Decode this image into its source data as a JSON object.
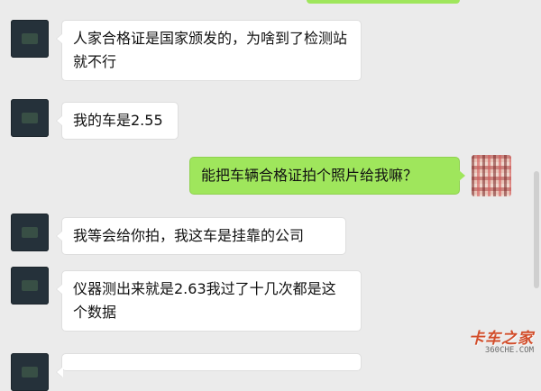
{
  "chat": {
    "messages": [
      {
        "sender": "contact",
        "text": "人家合格证是国家颁发的，为啥到了检测站就不行"
      },
      {
        "sender": "contact",
        "text": "我的车是2.55"
      },
      {
        "sender": "self",
        "text": "能把车辆合格证拍个照片给我嘛？"
      },
      {
        "sender": "contact",
        "text": "我等会给你拍，我这车是挂靠的公司"
      },
      {
        "sender": "contact",
        "text": "仪器测出来就是2.63我过了十几次都是这个数据"
      }
    ]
  },
  "watermark": {
    "text": "卡车之家",
    "url": "360CHE.COM"
  },
  "colors": {
    "background": "#ebebeb",
    "incoming_bubble": "#ffffff",
    "outgoing_bubble": "#9fe65c",
    "watermark": "#d24d2a"
  },
  "icons": {
    "contact_avatar": "avatar-icon",
    "self_avatar": "avatar-icon-pixelated"
  }
}
